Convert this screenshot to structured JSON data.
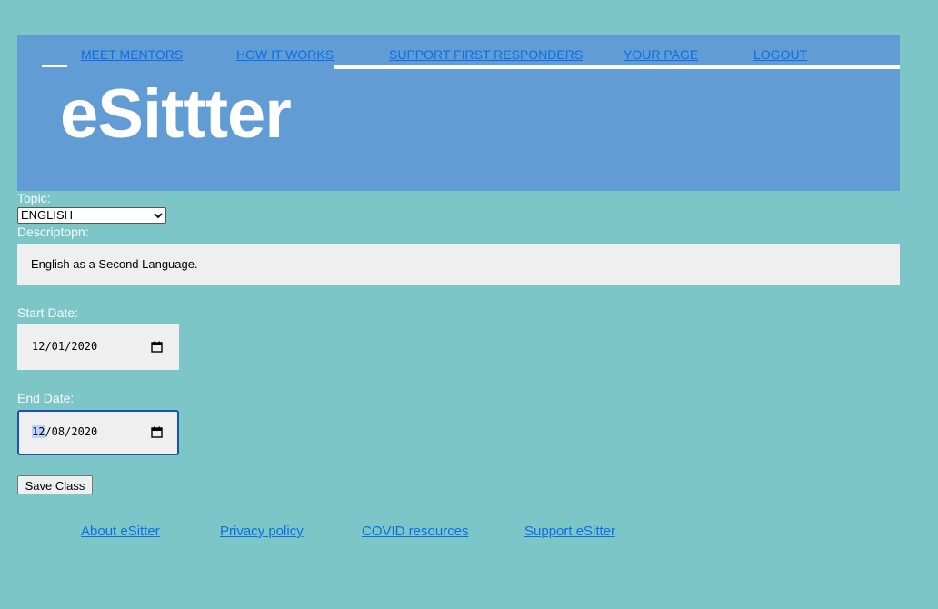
{
  "nav": {
    "items": [
      {
        "label": "MEET MENTORS"
      },
      {
        "label": "HOW IT WORKS"
      },
      {
        "label": "SUPPORT FIRST RESPONDERS"
      },
      {
        "label": "YOUR PAGE"
      },
      {
        "label": "LOGOUT"
      }
    ]
  },
  "logo": {
    "text": "eSittter"
  },
  "form": {
    "topic_label": "Topic:",
    "topic_value": "ENGLISH",
    "description_label": "Descriptopn:",
    "description_value": "English as a Second Language.",
    "start_label": "Start Date:",
    "start_value": {
      "month": "12",
      "rest": "/01/2020"
    },
    "end_label": "End Date:",
    "end_value": {
      "month": "12",
      "rest": "/08/2020"
    },
    "save_label": "Save Class"
  },
  "footer": {
    "links": [
      {
        "label": "About eSitter"
      },
      {
        "label": "Privacy policy"
      },
      {
        "label": "COVID resources"
      },
      {
        "label": "Support eSitter"
      }
    ]
  },
  "colors": {
    "background": "#7cc6c8",
    "header": "#619dd4",
    "link": "#0a6ee8",
    "focus": "#1d52b2"
  },
  "icons": {
    "date_picker": "calendar-icon",
    "select": "chevron-down-icon"
  }
}
